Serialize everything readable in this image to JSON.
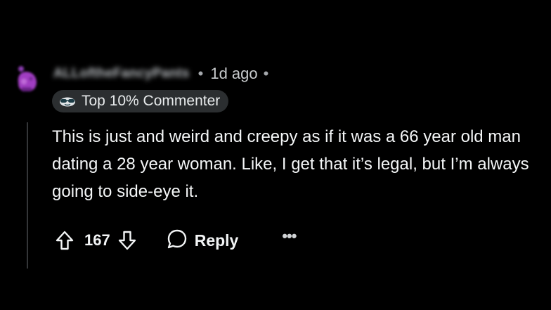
{
  "comment": {
    "username": "ALLoftheFancyPants",
    "separator": "•",
    "timestamp": "1d ago",
    "trailing_separator": "•",
    "flair": {
      "icon": "sunglasses-face-icon",
      "label": "Top 10% Commenter"
    },
    "body": "This is just and weird and creepy as if it was a 66 year old man dating a 28 year woman. Like, I get that it’s legal, but I’m always going to side-eye it.",
    "actions": {
      "upvote_icon": "arrow-up-icon",
      "score": "167",
      "downvote_icon": "arrow-down-icon",
      "reply_icon": "speech-bubble-icon",
      "reply_label": "Reply",
      "more_label": "•••"
    }
  },
  "colors": {
    "background": "#000000",
    "text": "#f2f4f5",
    "muted_text": "#a4a8ac",
    "flair_background": "#2b2e30",
    "avatar_accent": "#a13cc2",
    "thread_line": "#343638"
  }
}
